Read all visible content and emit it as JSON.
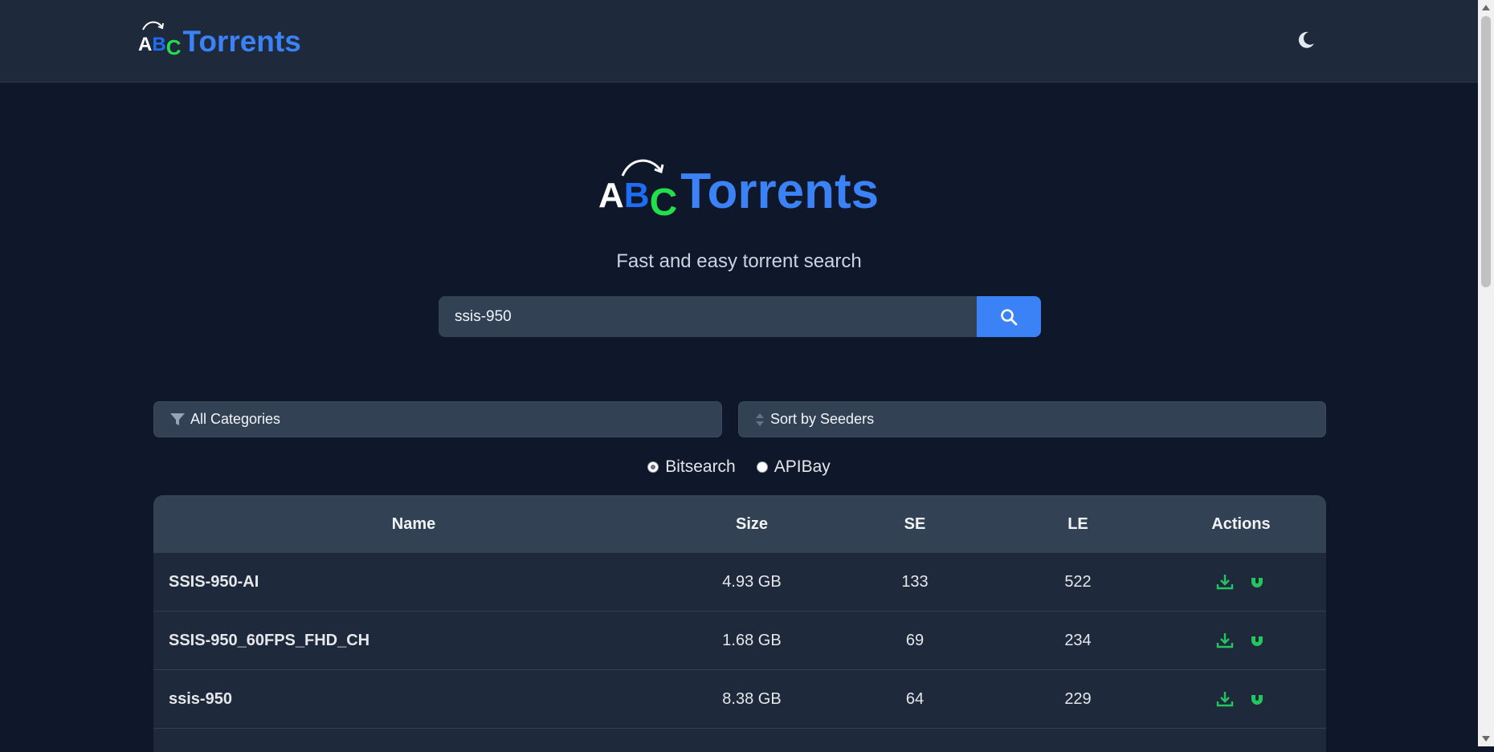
{
  "header": {
    "logo_letters": [
      "A",
      "B",
      "C"
    ],
    "logo_word": "Torrents",
    "theme_toggle_icon": "moon-icon"
  },
  "hero": {
    "logo_letters": [
      "A",
      "B",
      "C"
    ],
    "logo_word": "Torrents",
    "tagline": "Fast and easy torrent search"
  },
  "search": {
    "value": "ssis-950",
    "button_icon": "search-icon"
  },
  "filters": {
    "category": {
      "label": "All Categories",
      "icon": "filter-icon"
    },
    "sort": {
      "label": "Sort by Seeders",
      "icon": "sort-icon"
    }
  },
  "sources": [
    {
      "label": "Bitsearch",
      "checked": true
    },
    {
      "label": "APIBay",
      "checked": false
    }
  ],
  "table": {
    "headers": {
      "name": "Name",
      "size": "Size",
      "se": "SE",
      "le": "LE",
      "actions": "Actions"
    },
    "rows": [
      {
        "name": "SSIS-950-AI",
        "size": "4.93 GB",
        "se": "133",
        "le": "522"
      },
      {
        "name": "SSIS-950_60FPS_FHD_CH",
        "size": "1.68 GB",
        "se": "69",
        "le": "234"
      },
      {
        "name": "ssis-950",
        "size": "8.38 GB",
        "se": "64",
        "le": "229"
      }
    ],
    "action_icons": [
      "download-icon",
      "magnet-icon"
    ]
  },
  "colors": {
    "background": "#0f172a",
    "header_bg": "#1e293b",
    "accent": "#3b82f6",
    "action_green": "#22c55e",
    "logo_blue": "#1e6ef5",
    "logo_green": "#22e04b"
  }
}
